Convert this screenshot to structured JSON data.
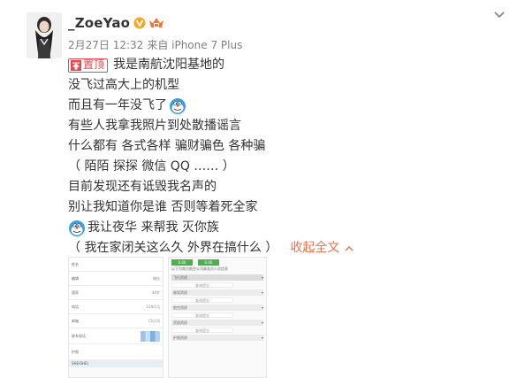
{
  "post": {
    "username": "_ZoeYao",
    "timestamp": "2月27日 12:32",
    "source": "来自 iPhone 7 Plus",
    "pin_label": "置顶",
    "lines": {
      "l1": "我是南航沈阳基地的",
      "l2": "没飞过高大上的机型",
      "l3": "而且有一年没飞了",
      "l4": "有些人我拿我照片到处散播谣言",
      "l5": "什么都有 各式各样 骗财骗色 各种骗",
      "l6": "（ 陌陌 探探 微信 QQ …… ）",
      "l7": "目前发现还有诋毁我名声的",
      "l8": "别让我知道你是谁  否则等着死全家",
      "l9": "我让夜华  来帮我  灭你族",
      "l10": "（ 我在家闭关这么久 外界在搞什么 ）"
    },
    "collapse_label": "收起全文",
    "icons": {
      "verified": "verified-v-badge",
      "level": "member-level-badge",
      "pin": "pin-top-icon",
      "emoji1": "doraemon-emoji",
      "emoji2": "doraemon-emoji",
      "more": "chevron-down-icon",
      "collapse": "chevron-up-icon"
    },
    "colors": {
      "accent": "#eb7350",
      "pin": "#e5484d",
      "verified": "#f5a623"
    }
  },
  "thumb1": {
    "rows": [
      {
        "label": "姓名",
        "value": ""
      },
      {
        "label": "编辑",
        "value": "姚佳"
      },
      {
        "label": "国家",
        "value": "40岁"
      },
      {
        "label": "电话",
        "value": "21年1月"
      },
      {
        "label": "邮箱",
        "value": "CS公司"
      },
      {
        "label": "联系电话",
        "value": ""
      },
      {
        "label": "护照",
        "value": ""
      }
    ],
    "footer": "SHE(SHE)"
  },
  "thumb2": {
    "green_buttons": [
      "0.00",
      "0.00"
    ],
    "note": "以下为南方航空公司乘务员人员信息",
    "bars": [
      "飞行资质",
      "继续资质",
      "航空资质",
      "资质资质",
      "护照资质"
    ],
    "sub_button": "查询提交"
  }
}
